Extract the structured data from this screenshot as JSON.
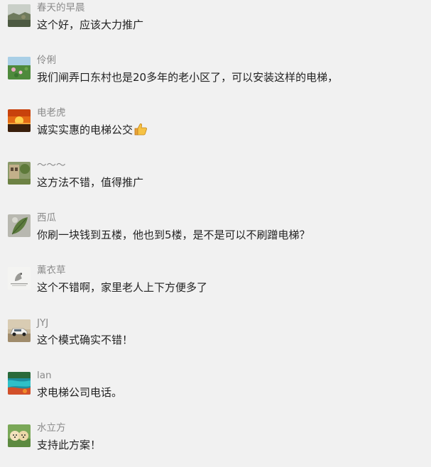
{
  "comments": [
    {
      "nickname": "春天的早晨",
      "text": "这个好，应该大力推广",
      "avatar_icon": "landscape-avatar-icon"
    },
    {
      "nickname": "伶俐",
      "text": "我们闸弄口东村也是20多年的老小区了，可以安装这样的电梯，",
      "avatar_icon": "lotus-pond-avatar-icon"
    },
    {
      "nickname": "电老虎",
      "text": "诚实实惠的电梯公交",
      "emoji": "thumbs-up-icon",
      "avatar_icon": "sunset-avatar-icon"
    },
    {
      "nickname": "～～～",
      "text": "这方法不错，值得推广",
      "avatar_icon": "garden-avatar-icon"
    },
    {
      "nickname": "西瓜",
      "text": "你刷一块钱到五楼，他也到5楼，是不是可以不刷蹭电梯？",
      "avatar_icon": "leaf-avatar-icon"
    },
    {
      "nickname": "薰衣草",
      "text": "这个不错啊，家里老人上下方便多了",
      "avatar_icon": "bird-sketch-avatar-icon"
    },
    {
      "nickname": "JYJ",
      "text": "这个模式确实不错！",
      "avatar_icon": "car-avatar-icon"
    },
    {
      "nickname": "lan",
      "text": "求电梯公司电话。",
      "avatar_icon": "colorful-lake-avatar-icon"
    },
    {
      "nickname": "水立方",
      "text": "支持此方案！",
      "avatar_icon": "puppies-avatar-icon"
    }
  ]
}
